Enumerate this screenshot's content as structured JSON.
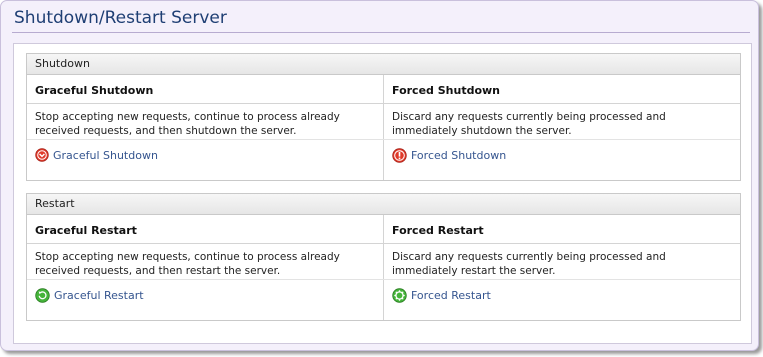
{
  "page": {
    "title": "Shutdown/Restart Server"
  },
  "shutdown": {
    "section_label": "Shutdown",
    "graceful": {
      "heading": "Graceful Shutdown",
      "description_line1": "Stop accepting new requests, continue to process already",
      "description_line2": "received requests, and then shutdown the server.",
      "action_label": "Graceful Shutdown",
      "icon": "graceful-shutdown-icon"
    },
    "forced": {
      "heading": "Forced Shutdown",
      "description_line1": "Discard any requests currently being processed and",
      "description_line2": "immediately shutdown the server.",
      "action_label": "Forced Shutdown",
      "icon": "forced-shutdown-icon"
    }
  },
  "restart": {
    "section_label": "Restart",
    "graceful": {
      "heading": "Graceful Restart",
      "description_line1": "Stop accepting new requests, continue to process already",
      "description_line2": "received requests, and then restart the server.",
      "action_label": "Graceful Restart",
      "icon": "graceful-restart-icon"
    },
    "forced": {
      "heading": "Forced Restart",
      "description_line1": "Discard any requests currently being processed and",
      "description_line2": "immediately restart the server.",
      "action_label": "Forced Restart",
      "icon": "forced-restart-icon"
    }
  },
  "colors": {
    "title": "#1f3f74",
    "link": "#35558f",
    "shutdown_icon": "#e03a2a",
    "restart_icon": "#45b43a",
    "panel_bg": "#f4f0fb"
  }
}
